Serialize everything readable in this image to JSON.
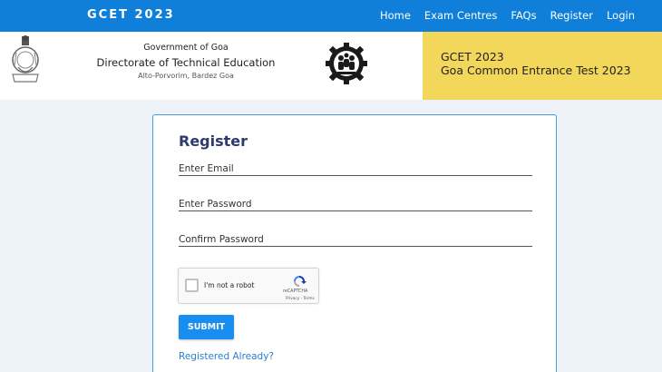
{
  "topbar": {
    "brand": "GCET 2023",
    "nav": [
      "Home",
      "Exam Centres",
      "FAQs",
      "Register",
      "Login"
    ]
  },
  "header": {
    "gov_line1": "Government of Goa",
    "gov_line2": "Directorate of Technical Education",
    "gov_line3": "Alto-Porvorim, Bardez Goa",
    "exam_line1": "GCET 2023",
    "exam_line2": "Goa Common Entrance Test 2023"
  },
  "form": {
    "title": "Register",
    "email_placeholder": "Enter Email",
    "password_placeholder": "Enter Password",
    "confirm_placeholder": "Confirm Password",
    "captcha_label": "I'm not a robot",
    "captcha_brand": "reCAPTCHA",
    "captcha_links": "Privacy - Terms",
    "submit_label": "SUBMIT",
    "registered_link": "Registered Already?"
  },
  "colors": {
    "nav_bg": "#0f7fd9",
    "exam_box": "#f2d75b",
    "page_bg": "#eef3fa",
    "submit": "#1a8df0"
  }
}
